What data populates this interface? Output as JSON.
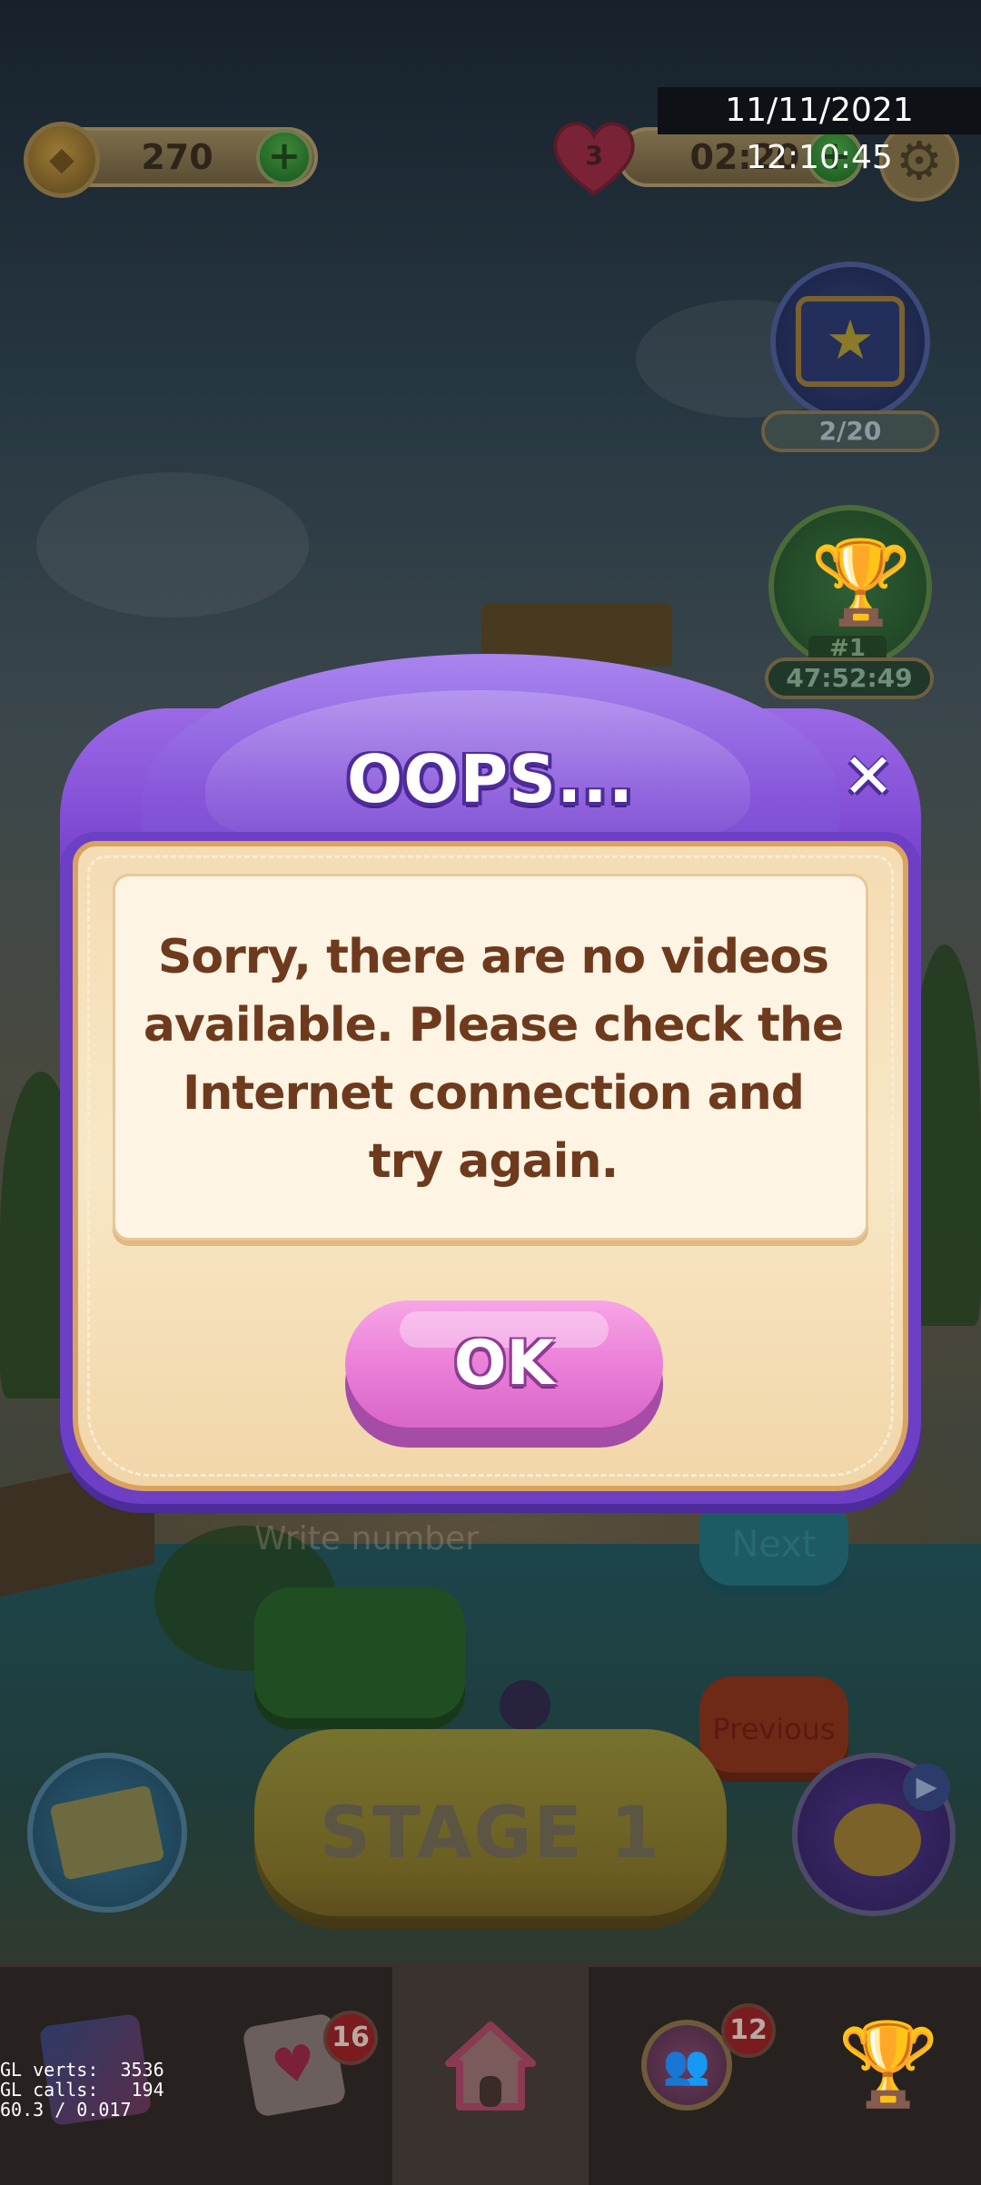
{
  "status": {
    "timestamp": "11/11/2021 12:10:45"
  },
  "top_bar": {
    "coins": "270",
    "lives": "3",
    "life_timer": "02:20",
    "icons": [
      "coin-icon",
      "plus-icon",
      "heart-icon",
      "plus-icon",
      "gear-icon"
    ]
  },
  "side_widgets": {
    "album_progress": "2/20",
    "trophy_rank": "#1",
    "trophy_timer": "47:52:49"
  },
  "background_buttons": {
    "input_placeholder": "Write number",
    "next": "Next",
    "previous": "Previous",
    "stage": "STAGE 1"
  },
  "dialog": {
    "title": "OOPS...",
    "close": "✕",
    "message": "Sorry, there are no videos available. Please check the Internet connection and try again.",
    "ok": "OK"
  },
  "bottom_nav": {
    "tabs": [
      {
        "name": "cards",
        "icon": "cards-icon",
        "badge": ""
      },
      {
        "name": "mail",
        "icon": "mail-heart-icon",
        "badge": "16"
      },
      {
        "name": "home",
        "icon": "home-icon",
        "badge": ""
      },
      {
        "name": "friends",
        "icon": "friends-icon",
        "badge": "12"
      },
      {
        "name": "leaderboard",
        "icon": "trophy-icon",
        "badge": ""
      }
    ]
  },
  "debug": {
    "line1": "GL verts:  3536",
    "line2": "GL calls:   194",
    "line3": "60.3 / 0.017"
  },
  "colors": {
    "dialog_purple": "#7a44cf",
    "paper": "#f8e7c6",
    "message_text": "#6e3a1d",
    "ok_pink": "#ec83d9"
  }
}
